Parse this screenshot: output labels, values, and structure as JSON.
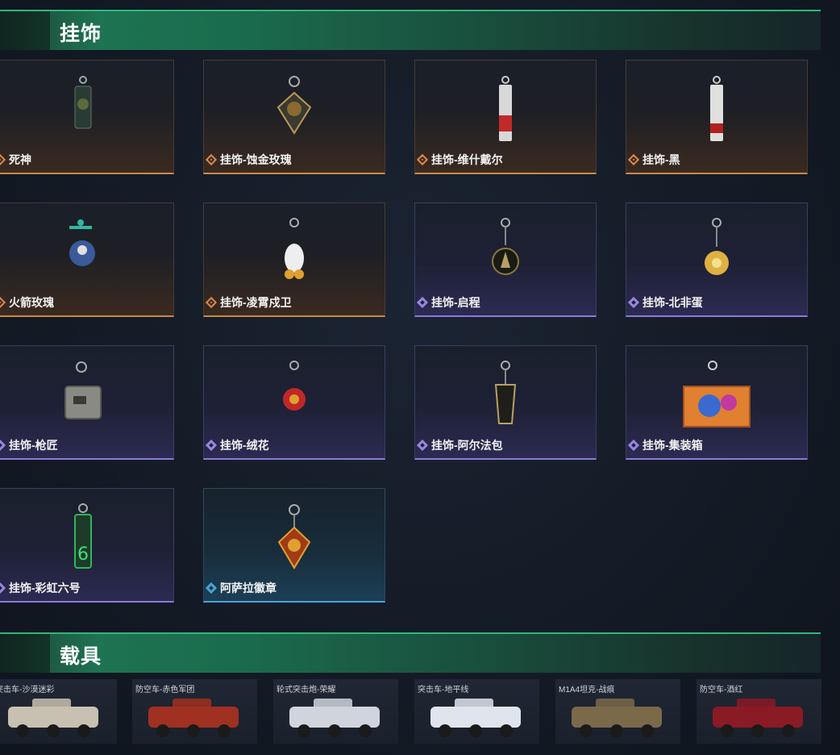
{
  "sections": {
    "charms_title": "挂饰",
    "vehicles_title": "载具"
  },
  "charms": [
    {
      "name": "死神",
      "rarity": "gold",
      "icon": "reaper-charm-icon"
    },
    {
      "name": "挂饰-蚀金玫瑰",
      "rarity": "gold",
      "icon": "golden-rose-charm-icon"
    },
    {
      "name": "挂饰-维什戴尔",
      "rarity": "gold",
      "icon": "vishdel-charm-icon"
    },
    {
      "name": "挂饰-黑",
      "rarity": "gold",
      "icon": "black-charm-icon"
    },
    {
      "name": "火箭玫瑰",
      "rarity": "gold",
      "icon": "rocket-rose-charm-icon"
    },
    {
      "name": "挂饰-凌霄戍卫",
      "rarity": "gold",
      "icon": "guardian-charm-icon"
    },
    {
      "name": "挂饰-启程",
      "rarity": "purple",
      "icon": "departure-charm-icon"
    },
    {
      "name": "挂饰-北非蛋",
      "rarity": "purple",
      "icon": "egg-charm-icon"
    },
    {
      "name": "挂饰-枪匠",
      "rarity": "purple",
      "icon": "gunsmith-charm-icon"
    },
    {
      "name": "挂饰-绒花",
      "rarity": "purple",
      "icon": "velvet-flower-charm-icon"
    },
    {
      "name": "挂饰-阿尔法包",
      "rarity": "purple",
      "icon": "alpha-pack-charm-icon"
    },
    {
      "name": "挂饰-集装箱",
      "rarity": "purple",
      "icon": "container-charm-icon"
    },
    {
      "name": "挂饰-彩虹六号",
      "rarity": "purple",
      "icon": "rainbow-six-charm-icon"
    },
    {
      "name": "阿萨拉徽章",
      "rarity": "blue",
      "icon": "asala-badge-charm-icon"
    }
  ],
  "vehicles": [
    {
      "name": "突击车-沙漠迷彩",
      "icon": "assault-vehicle-icon"
    },
    {
      "name": "防空车-赤色军团",
      "icon": "aa-vehicle-icon"
    },
    {
      "name": "轮式突击炮-荣耀",
      "icon": "wheeled-assault-gun-icon"
    },
    {
      "name": "突击车-地平线",
      "icon": "assault-vehicle-icon"
    },
    {
      "name": "M1A4坦克-战痕",
      "icon": "tank-icon"
    },
    {
      "name": "防空车-酒红",
      "icon": "aa-vehicle-icon"
    }
  ],
  "colors": {
    "accent_green": "#2fb77a",
    "rarity_gold": "#e0894a",
    "rarity_purple": "#9a86e0",
    "rarity_blue": "#4aa3d6"
  }
}
